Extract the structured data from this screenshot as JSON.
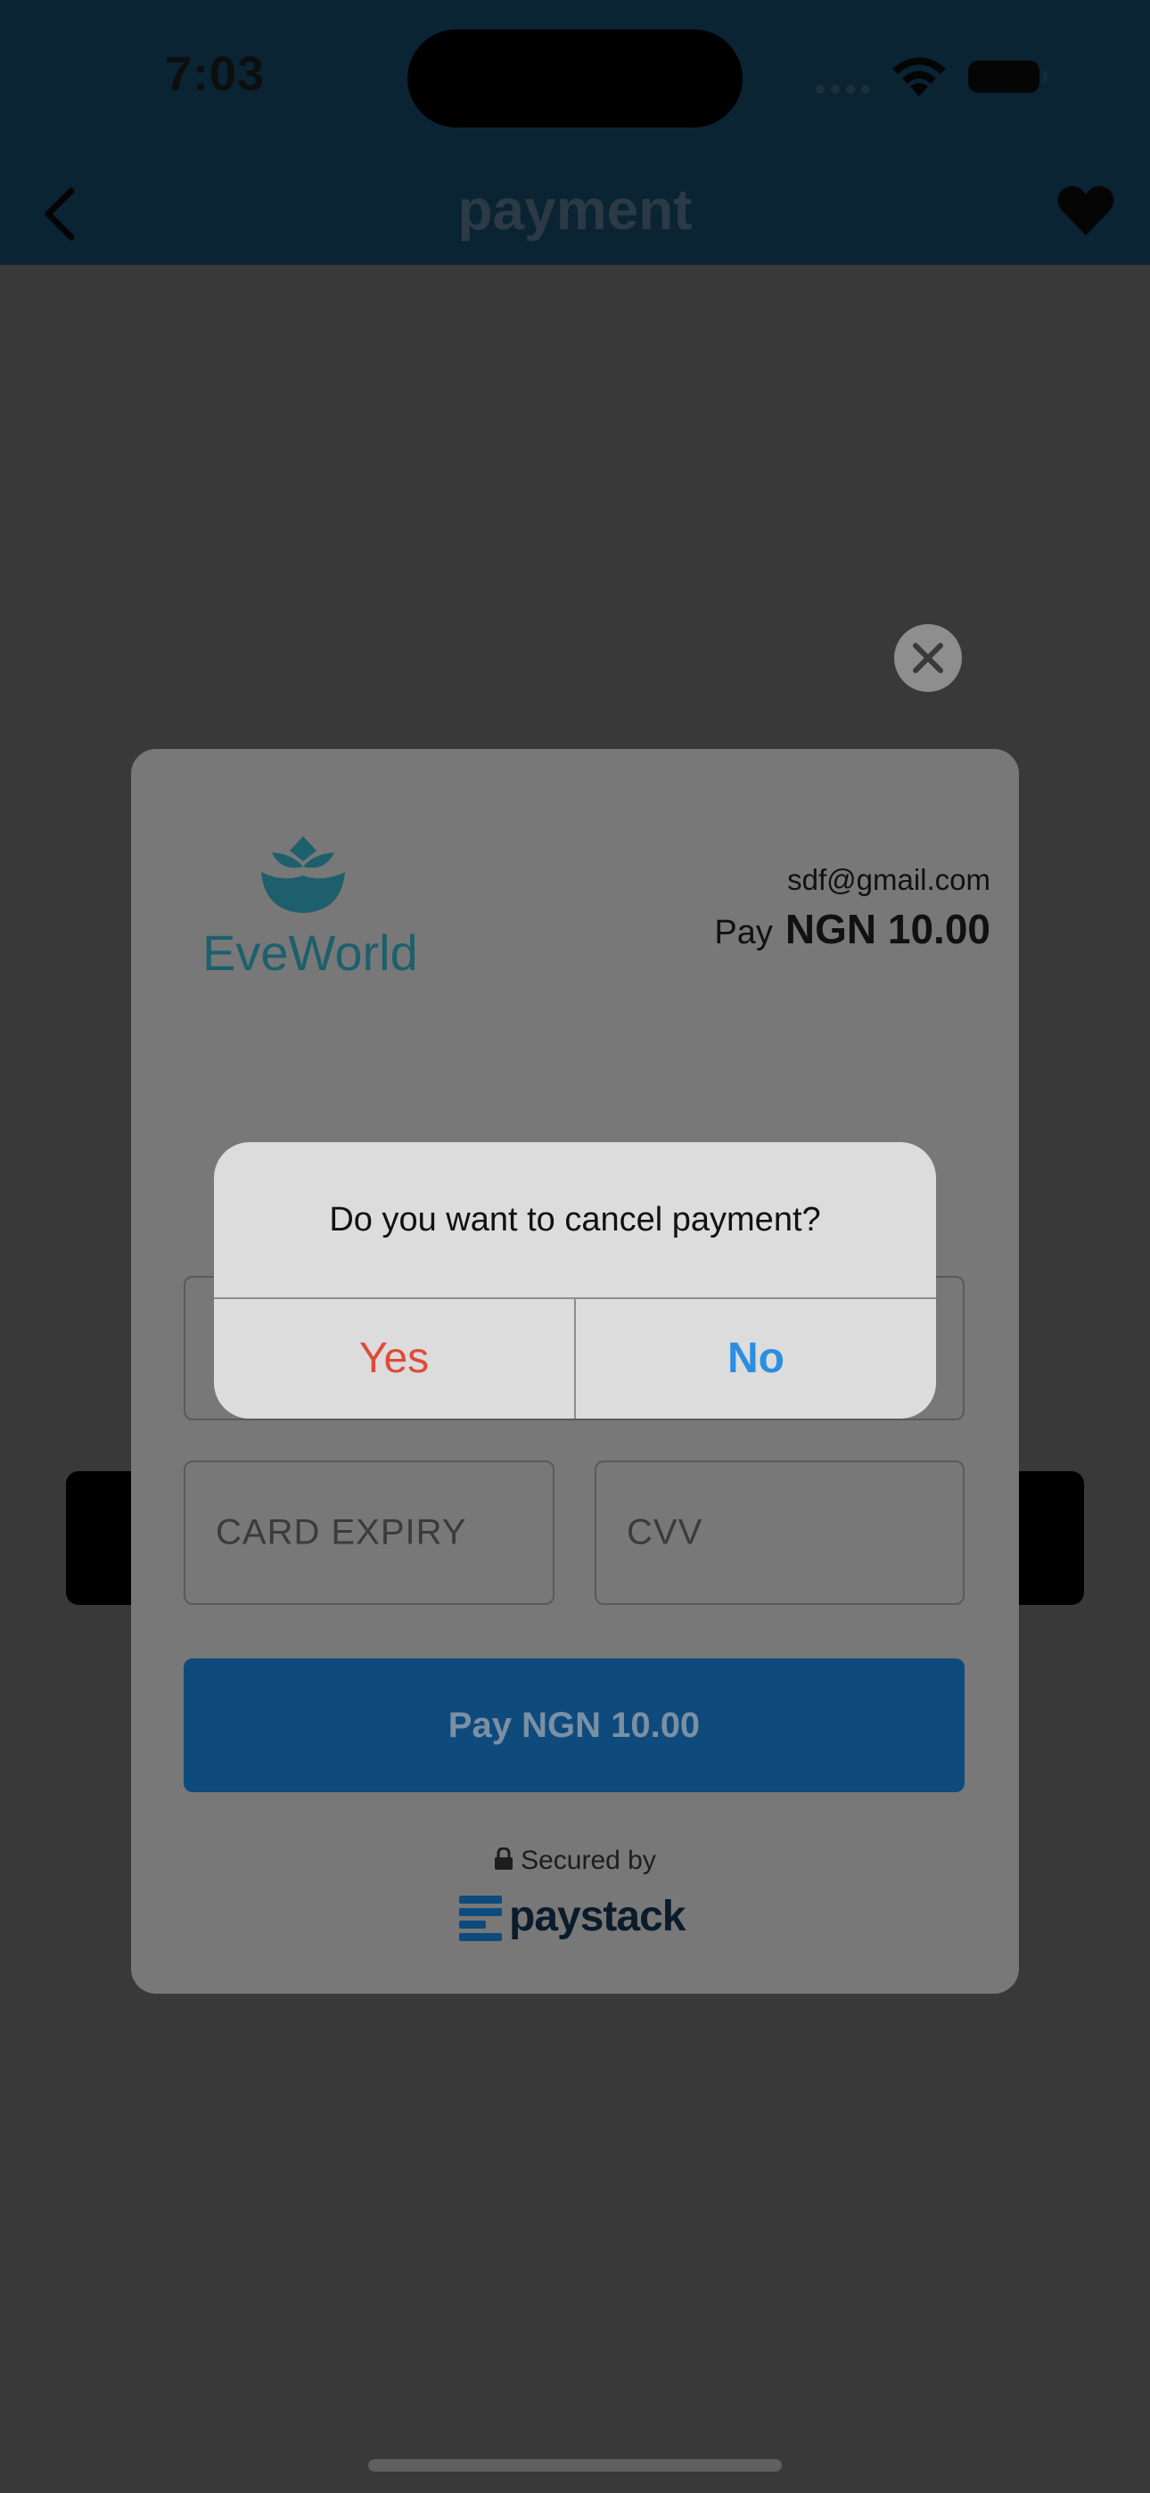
{
  "status_bar": {
    "time": "7:03"
  },
  "nav": {
    "title": "payment",
    "back_icon": "chevron-left-icon",
    "favorite_icon": "heart-icon"
  },
  "checkout": {
    "merchant_name": "EveWorld",
    "email": "sdf@gmail.com",
    "pay_label": "Pay",
    "amount": "NGN 10.00",
    "card_expiry_placeholder": "CARD EXPIRY",
    "cvv_placeholder": "CVV",
    "pay_button_label": "Pay NGN 10.00",
    "secured_by": "Secured by",
    "provider": "paystack"
  },
  "alert": {
    "message": "Do you want to cancel payment?",
    "yes_label": "Yes",
    "no_label": "No"
  },
  "colors": {
    "nav_background": "#0a2434",
    "pay_button": "#0f4a7c",
    "alert_yes": "#e04a3c",
    "alert_no": "#2c8ee0",
    "brand_teal": "#1e5f6c"
  }
}
